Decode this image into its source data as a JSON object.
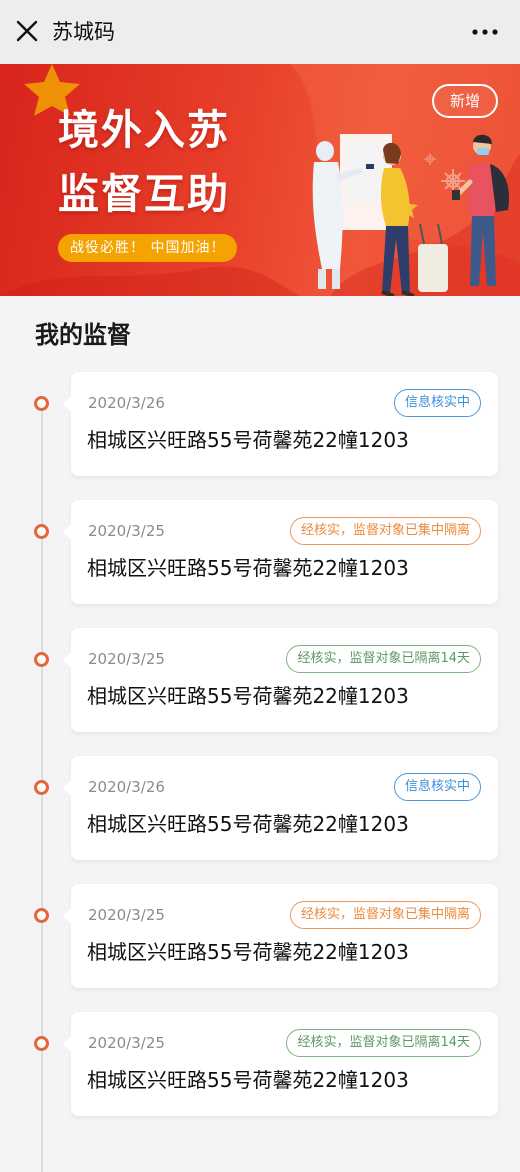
{
  "header": {
    "title": "苏城码",
    "close_icon": "close-icon",
    "more_icon": "more-dots-icon"
  },
  "banner": {
    "title_line1": "境外入苏",
    "title_line2": "监督互助",
    "slogan": "战役必胜！ 中国加油！",
    "add_button": "新增",
    "colors": {
      "background": "#e33a27",
      "slogan_bg": "#f5a300"
    }
  },
  "section": {
    "title": "我的监督"
  },
  "records": [
    {
      "date": "2020/3/26",
      "status": "信息核实中",
      "status_type": "blue",
      "address": "相城区兴旺路55号荷馨苑22幢1203"
    },
    {
      "date": "2020/3/25",
      "status": "经核实，监督对象已集中隔离",
      "status_type": "orange",
      "address": "相城区兴旺路55号荷馨苑22幢1203"
    },
    {
      "date": "2020/3/25",
      "status": "经核实，监督对象已隔离14天",
      "status_type": "green",
      "address": "相城区兴旺路55号荷馨苑22幢1203"
    },
    {
      "date": "2020/3/26",
      "status": "信息核实中",
      "status_type": "blue",
      "address": "相城区兴旺路55号荷馨苑22幢1203"
    },
    {
      "date": "2020/3/25",
      "status": "经核实，监督对象已集中隔离",
      "status_type": "orange",
      "address": "相城区兴旺路55号荷馨苑22幢1203"
    },
    {
      "date": "2020/3/25",
      "status": "经核实，监督对象已隔离14天",
      "status_type": "green",
      "address": "相城区兴旺路55号荷馨苑22幢1203"
    }
  ],
  "colors": {
    "blue": "#4a97dd",
    "orange": "#f0965a",
    "green": "#7fb482",
    "timeline_dot": "#e5663c"
  }
}
